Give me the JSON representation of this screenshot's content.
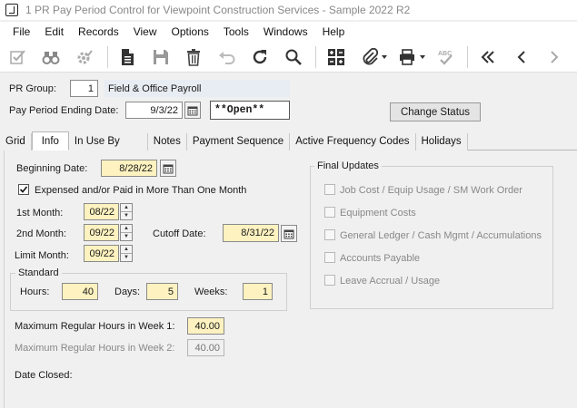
{
  "window": {
    "title": "1 PR Pay Period Control for Viewpoint Construction Services - Sample 2022 R2"
  },
  "menu": [
    "File",
    "Edit",
    "Records",
    "View",
    "Options",
    "Tools",
    "Windows",
    "Help"
  ],
  "header": {
    "pr_group_label": "PR Group:",
    "pr_group_value": "1",
    "pr_group_desc": "Field & Office Payroll",
    "pay_period_label": "Pay Period Ending Date:",
    "pay_period_value": "9/3/22",
    "status_value": "**Open**",
    "change_status_label": "Change Status"
  },
  "tabs": [
    "Grid",
    "Info",
    "In Use By",
    "Notes",
    "Payment Sequence",
    "Active Frequency Codes",
    "Holidays"
  ],
  "info": {
    "beginning_date_label": "Beginning Date:",
    "beginning_date_value": "8/28/22",
    "expensed_label": "Expensed and/or Paid in More Than One Month",
    "first_month_label": "1st Month:",
    "first_month_value": "08/22",
    "second_month_label": "2nd Month:",
    "second_month_value": "09/22",
    "cutoff_date_label": "Cutoff Date:",
    "cutoff_date_value": "8/31/22",
    "limit_month_label": "Limit Month:",
    "limit_month_value": "09/22",
    "standard_title": "Standard",
    "hours_label": "Hours:",
    "hours_value": "40",
    "days_label": "Days:",
    "days_value": "5",
    "weeks_label": "Weeks:",
    "weeks_value": "1",
    "max_week1_label": "Maximum Regular Hours in Week 1:",
    "max_week1_value": "40.00",
    "max_week2_label": "Maximum Regular Hours in Week 2:",
    "max_week2_value": "40.00",
    "date_closed_label": "Date Closed:"
  },
  "final_updates": {
    "title": "Final Updates",
    "items": [
      "Job Cost / Equip Usage / SM Work Order",
      "Equipment Costs",
      "General Ledger / Cash Mgmt / Accumulations",
      "Accounts Payable",
      "Leave Accrual / Usage"
    ]
  },
  "colors": {
    "required_field": "#fdf2c0",
    "panel_bg": "#f0f0f0"
  }
}
